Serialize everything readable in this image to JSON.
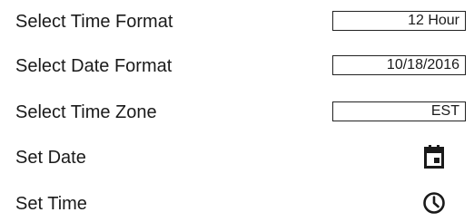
{
  "settings": {
    "time_format": {
      "label": "Select Time Format",
      "value": "12 Hour"
    },
    "date_format": {
      "label": "Select Date Format",
      "value": "10/18/2016"
    },
    "time_zone": {
      "label": "Select Time Zone",
      "value": "EST"
    },
    "set_date": {
      "label": "Set Date",
      "icon": "calendar-icon"
    },
    "set_time": {
      "label": "Set Time",
      "icon": "clock-icon"
    }
  },
  "colors": {
    "text": "#1a1a1a",
    "border": "#222222",
    "background": "#ffffff"
  }
}
